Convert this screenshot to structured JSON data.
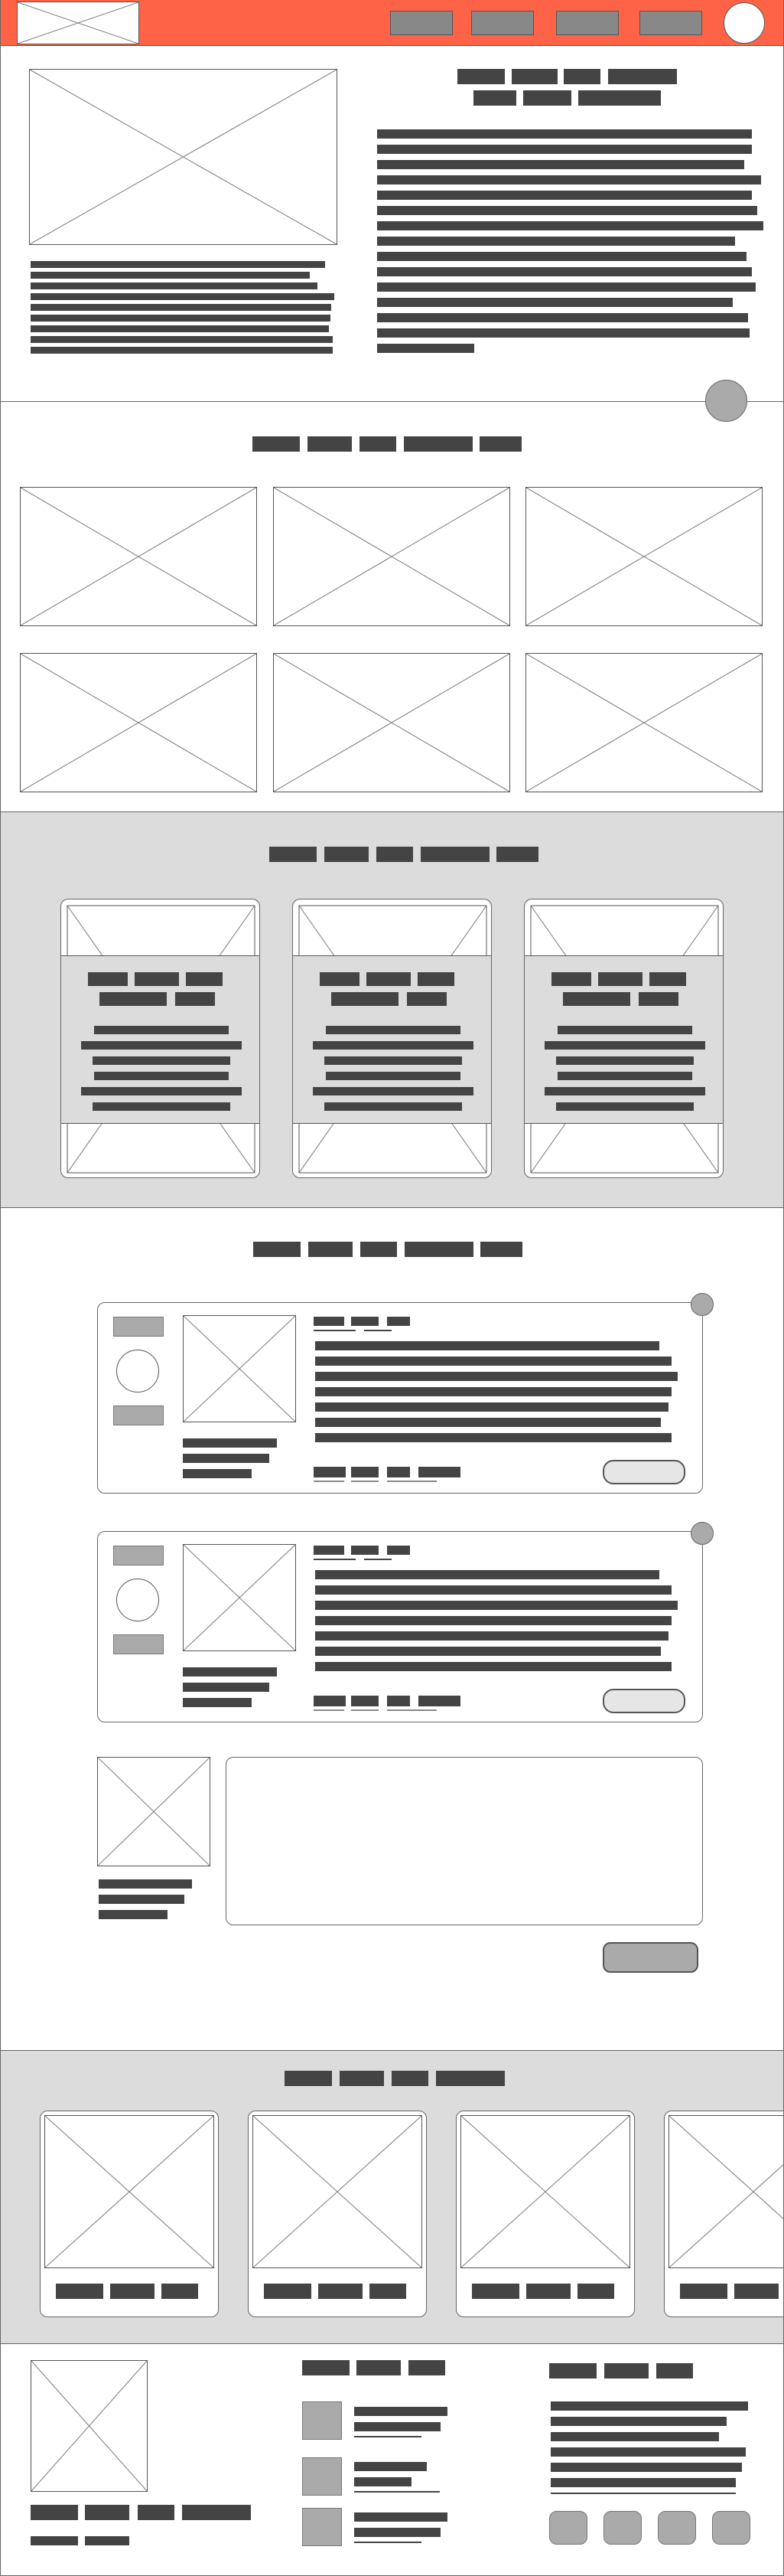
{
  "header": {
    "background_color": "#ff6347",
    "logo_icon": "image-placeholder-icon",
    "nav_item_count": 4,
    "avatar_icon": "profile-avatar-icon"
  },
  "sections": {
    "hero": {
      "image_icon": "image-placeholder-icon",
      "scroll_button_icon": "circle-button-icon"
    },
    "gallery": {
      "image_icon": "image-placeholder-icon",
      "tile_count": 6
    },
    "cards": {
      "background_color": "#dcdcdc",
      "card_count": 3
    },
    "comments": {
      "entry_count": 2,
      "submit_button_icon": "submit-button-icon"
    },
    "carousel": {
      "background_color": "#dcdcdc",
      "card_count": 4
    },
    "footer": {
      "social_icon_count": 4
    }
  }
}
